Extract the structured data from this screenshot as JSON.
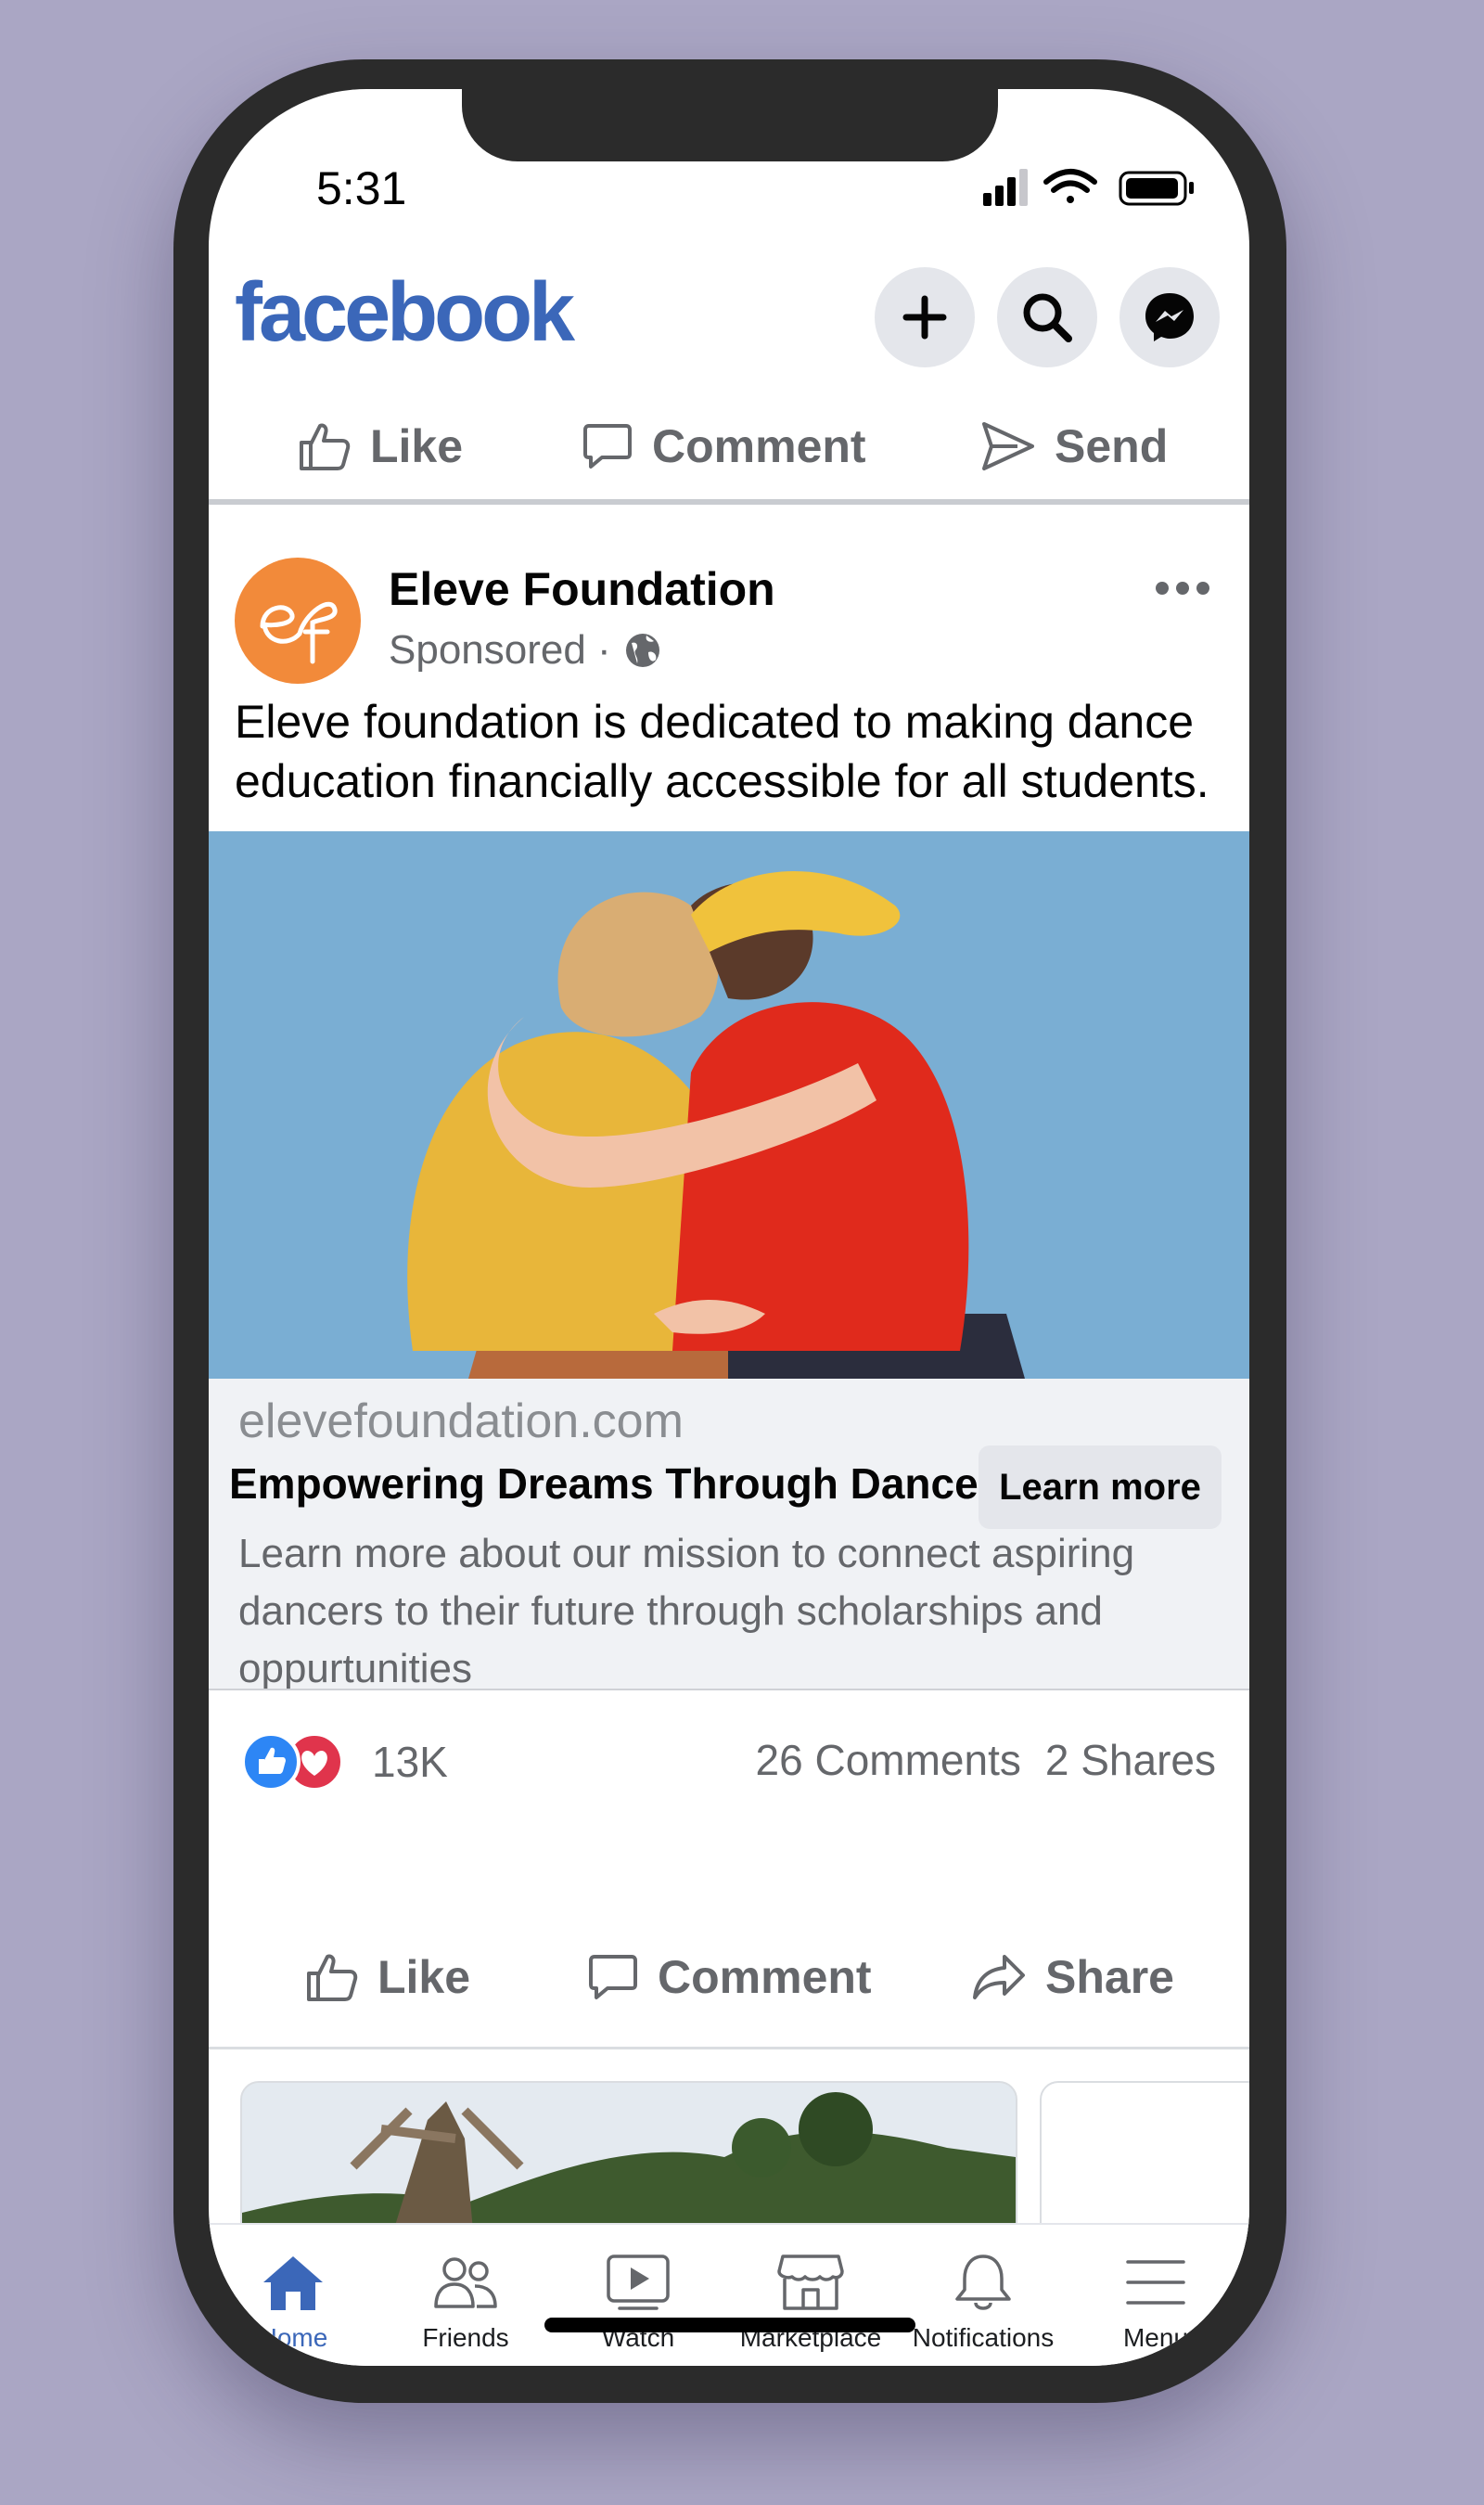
{
  "status_bar": {
    "time": "5:31"
  },
  "header": {
    "logo": "facebook",
    "icons": [
      "plus-icon",
      "search-icon",
      "messenger-icon"
    ]
  },
  "top_actions": {
    "like": "Like",
    "comment": "Comment",
    "send": "Send"
  },
  "post": {
    "page_name": "Eleve Foundation",
    "sponsored": "Sponsored ·",
    "avatar_text": "ef",
    "text": "Eleve foundation is dedicated to making dance education financially accessible for all students.",
    "link": {
      "domain": "elevefoundation.com",
      "title": "Empowering Dreams Through Dance",
      "cta": "Learn more",
      "description": "Learn more about our mission to connect aspiring dancers to their future through scholarships and oppurtunities"
    },
    "reaction_count": "13K",
    "comments": "26 Comments",
    "shares": "2 Shares",
    "actions": {
      "like": "Like",
      "comment": "Comment",
      "share": "Share"
    }
  },
  "tabs": [
    {
      "label": "Home",
      "icon": "home-icon",
      "active": true
    },
    {
      "label": "Friends",
      "icon": "friends-icon"
    },
    {
      "label": "Watch",
      "icon": "watch-icon"
    },
    {
      "label": "Marketplace",
      "icon": "marketplace-icon"
    },
    {
      "label": "Notifications",
      "icon": "bell-icon"
    },
    {
      "label": "Menu",
      "icon": "menu-icon"
    }
  ],
  "colors": {
    "brand": "#3b67b9",
    "background": "#aaa6c4",
    "avatar": "#f28a3a",
    "love": "#e0344c"
  }
}
